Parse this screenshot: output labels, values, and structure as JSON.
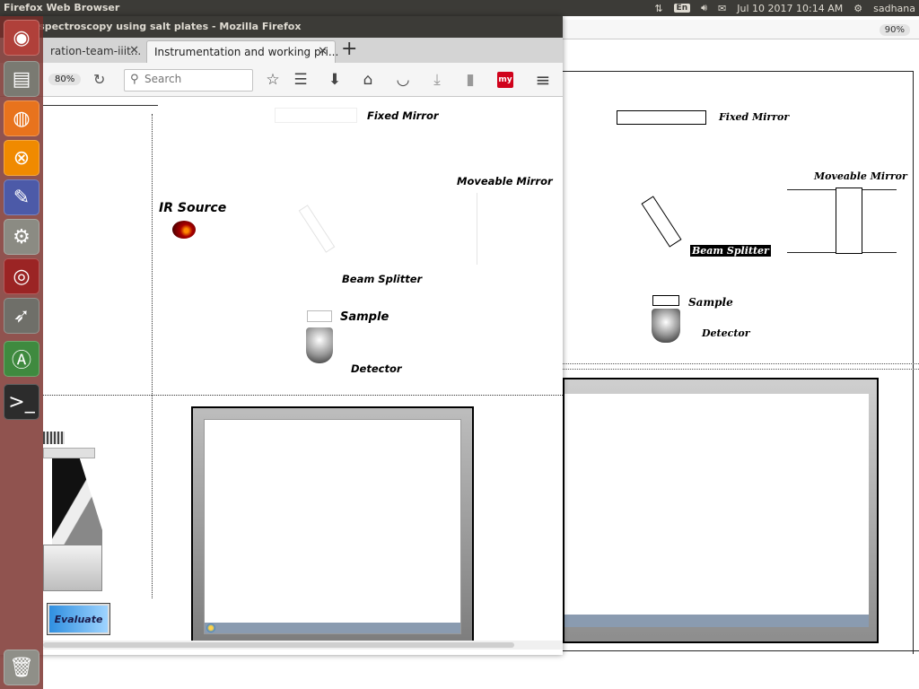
{
  "panel": {
    "app_title": "Firefox Web Browser",
    "keyboard_layout": "En",
    "datetime": "Jul 10 2017 10:14 AM",
    "user": "sadhana"
  },
  "background_window": {
    "zoom": "90%",
    "labels": {
      "fixed_mirror": "Fixed Mirror",
      "moveable_mirror": "Moveable Mirror",
      "beam_splitter": "Beam Splitter",
      "sample": "Sample",
      "detector": "Detector"
    }
  },
  "window": {
    "title": "ed spectroscopy using salt plates - Mozilla Firefox",
    "tabs": [
      {
        "label": "ration-team-iiit..."
      },
      {
        "label": "Instrumentation and working pri..."
      }
    ],
    "new_tab": "+"
  },
  "toolbar": {
    "zoom": "80%",
    "search_placeholder": "Search",
    "my_badge": "my"
  },
  "diagram": {
    "fixed_mirror": "Fixed Mirror",
    "moveable_mirror": "Moveable Mirror",
    "ir_source": "IR Source",
    "beam_splitter": "Beam Splitter",
    "sample": "Sample",
    "detector": "Detector",
    "evaluate_button": "Evaluate"
  },
  "icons": {
    "launcher": [
      "ubuntu-dash-icon",
      "files-icon",
      "firefox-icon",
      "app-x-icon",
      "text-editor-icon",
      "system-settings-icon",
      "app-swirl-icon",
      "rocket-icon",
      "software-updater-icon",
      "terminal-icon",
      "trash-icon"
    ]
  }
}
